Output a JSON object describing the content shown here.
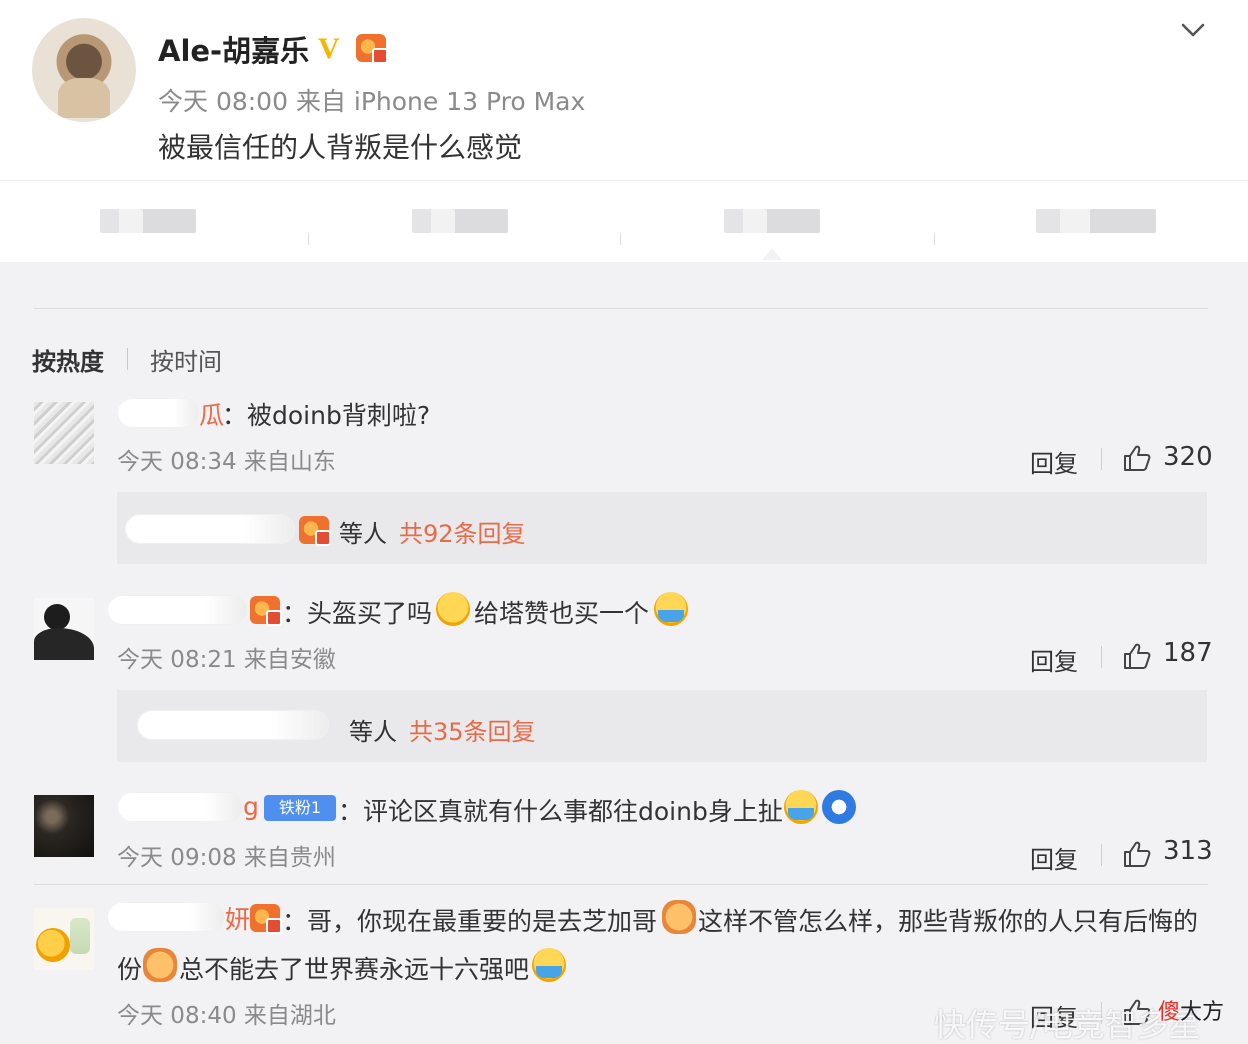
{
  "post": {
    "author": "Ale-胡嘉乐",
    "verified_mark": "V",
    "meta": "今天 08:00 来自 iPhone 13 Pro Max",
    "text": "被最信任的人背叛是什么感觉",
    "menu_icon": "chevron-down-icon"
  },
  "sort": {
    "hot": "按热度",
    "time": "按时间"
  },
  "comments": [
    {
      "name_suffix": "瓜",
      "text": "：被doinb背刺啦?",
      "meta": "今天 08:34 来自山东",
      "reply_label": "回复",
      "likes": "320",
      "replies_who": "等人",
      "replies_total": "共92条回复"
    },
    {
      "text": "：头盔买了吗",
      "text2": "给塔赞也买一个",
      "meta": "今天 08:21 来自安徽",
      "reply_label": "回复",
      "likes": "187",
      "replies_who": "等人",
      "replies_total": "共35条回复"
    },
    {
      "name_suffix": "g",
      "fan_label": "铁粉1",
      "text": "：评论区真就有什么事都往doinb身上扯",
      "meta": "今天 09:08 来自贵州",
      "reply_label": "回复",
      "likes": "313"
    },
    {
      "name_suffix": "妍",
      "text": "：哥，你现在最重要的是去芝加哥",
      "text2": "这样不管怎么样，那些背叛你的人只有后悔的",
      "text3": "份",
      "text4": "总不能去了世界赛永远十六强吧",
      "meta": "今天 08:40 来自湖北",
      "reply_label": "回复"
    }
  ],
  "watermark": {
    "text": "快传号/电竞智多星",
    "logo_a": "傻",
    "logo_b": "大方"
  }
}
